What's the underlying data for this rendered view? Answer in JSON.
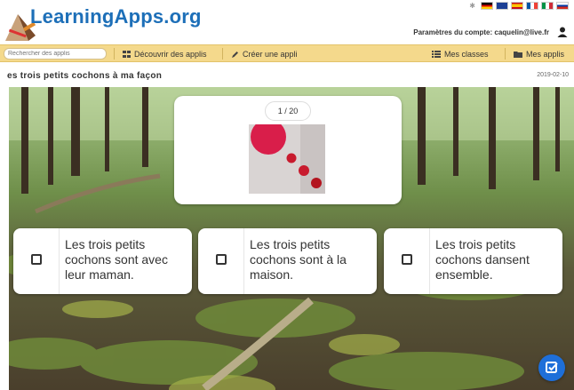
{
  "header": {
    "logo_text": "LearningApps.org",
    "account_text": "Paramètres du compte: caquelin@live.fr",
    "language_flags": [
      "german-flag",
      "uk-flag",
      "spanish-flag",
      "french-flag",
      "italian-flag",
      "russian-flag"
    ]
  },
  "nav": {
    "search_placeholder": "Rechercher des applis",
    "discover": "Découvrir des applis",
    "create": "Créer une appli",
    "classes": "Mes classes",
    "apps": "Mes applis"
  },
  "app": {
    "title": "es trois petits cochons à ma façon",
    "date": "2019-02-10"
  },
  "quiz": {
    "counter": "1 / 20",
    "answers": [
      {
        "text": "Les trois petits cochons sont avec leur maman."
      },
      {
        "text": "Les trois petits cochons sont à la maison."
      },
      {
        "text": "Les trois petits cochons dansent ensemble."
      }
    ]
  },
  "colors": {
    "brand": "#1d6fb8",
    "navbar": "#f4d98c",
    "fab": "#1e6fd9"
  }
}
